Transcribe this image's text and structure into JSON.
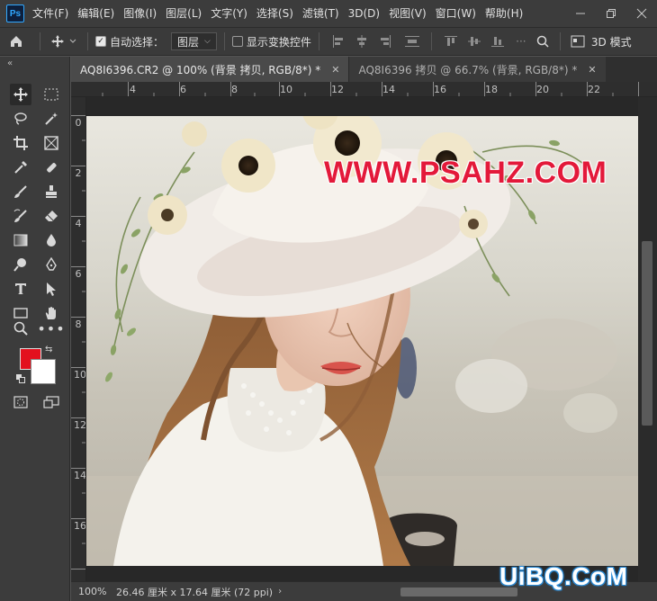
{
  "app": {
    "logo": "Ps"
  },
  "menubar": {
    "items": [
      "文件(F)",
      "编辑(E)",
      "图像(I)",
      "图层(L)",
      "文字(Y)",
      "选择(S)",
      "滤镜(T)",
      "3D(D)",
      "视图(V)",
      "窗口(W)",
      "帮助(H)"
    ],
    "window_controls": [
      "minimize",
      "restore",
      "close"
    ]
  },
  "options_bar": {
    "auto_select_label": "自动选择：",
    "auto_select_checked": true,
    "layer_dropdown": "图层",
    "show_transform_label": "显示变换控件",
    "show_transform_checked": false,
    "mode_3d_label": "3D 模式"
  },
  "tabs": [
    {
      "label": "AQ8I6396.CR2 @ 100% (背景 拷贝, RGB/8*) *",
      "active": true
    },
    {
      "label": "AQ8I6396 拷贝 @ 66.7% (背景, RGB/8*) *",
      "active": false
    }
  ],
  "ruler_top": [
    "4",
    "6",
    "8",
    "10",
    "12",
    "14",
    "16",
    "18",
    "20",
    "22"
  ],
  "ruler_left": [
    "0",
    "2",
    "4",
    "6",
    "8",
    "10",
    "12",
    "14",
    "16"
  ],
  "colors": {
    "foreground": "#e3101e",
    "background": "#ffffff",
    "accent": "#31a8ff"
  },
  "status": {
    "zoom": "100%",
    "doc_size": "26.46 厘米 x 17.64 厘米 (72 ppi)"
  },
  "canvas": {
    "watermark": "WWW.PSAHZ.COM"
  },
  "site_watermark": "UiBQ.CoM"
}
